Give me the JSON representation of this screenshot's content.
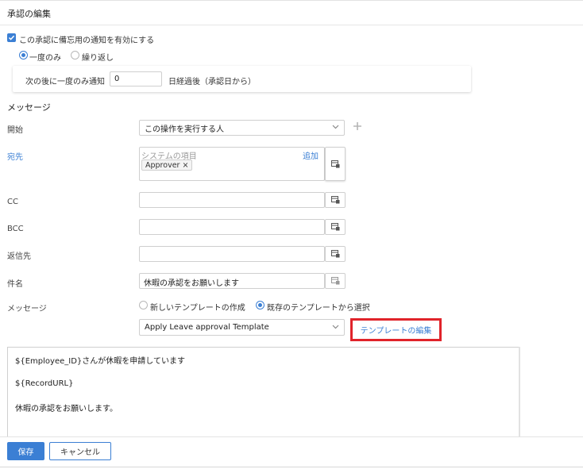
{
  "header": {
    "title": "承認の編集"
  },
  "reminder": {
    "enable_label": "この承認に備忘用の通知を有効にする",
    "enabled": true,
    "options": [
      {
        "label": "一度のみ",
        "selected": true
      },
      {
        "label": "繰り返し",
        "selected": false
      }
    ],
    "notify_prefix": "次の後に一度のみ通知",
    "notify_days": "0",
    "notify_suffix": "日経過後（承認日から）"
  },
  "message_section": {
    "title": "メッセージ",
    "from": {
      "label": "開始",
      "value": "この操作を実行する人"
    },
    "to": {
      "label": "宛先",
      "placeholder": "システムの項目",
      "add_label": "追加",
      "chips": [
        {
          "label": "Approver",
          "remove": "×"
        }
      ]
    },
    "cc": {
      "label": "CC",
      "value": ""
    },
    "bcc": {
      "label": "BCC",
      "value": ""
    },
    "reply_to": {
      "label": "返信先",
      "value": ""
    },
    "subject": {
      "label": "件名",
      "value": "休暇の承認をお願いします"
    },
    "message": {
      "label": "メッセージ",
      "options": [
        {
          "label": "新しいテンプレートの作成",
          "selected": false
        },
        {
          "label": "既存のテンプレートから選択",
          "selected": true
        }
      ],
      "template_value": "Apply Leave approval Template",
      "edit_template_label": "テンプレートの編集"
    },
    "body_lines": [
      "${Employee_ID}さんが休暇を申請しています",
      "${RecordURL}",
      "休暇の承認をお願いします。"
    ]
  },
  "footer": {
    "save_label": "保存",
    "cancel_label": "キャンセル"
  },
  "colors": {
    "accent": "#3b7fd4",
    "highlight": "#e0232a"
  },
  "icons": {
    "field_picker": "merge-field-icon",
    "dropdown": "chevron-down-icon",
    "add": "plus-icon",
    "remove": "close-icon"
  }
}
